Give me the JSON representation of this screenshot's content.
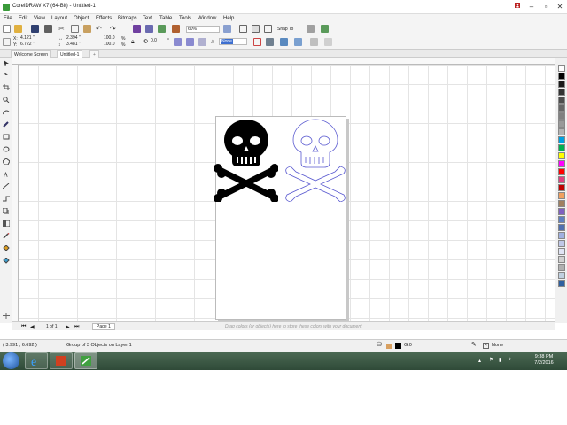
{
  "titlebar": {
    "title": "CorelDRAW X7 (64-Bit) - Untitled-1"
  },
  "menu": [
    {
      "label": "File"
    },
    {
      "label": "Edit"
    },
    {
      "label": "View"
    },
    {
      "label": "Layout"
    },
    {
      "label": "Object"
    },
    {
      "label": "Effects"
    },
    {
      "label": "Bitmaps"
    },
    {
      "label": "Text"
    },
    {
      "label": "Table"
    },
    {
      "label": "Tools"
    },
    {
      "label": "Window"
    },
    {
      "label": "Help"
    }
  ],
  "toolbar": {
    "zoom": "60%",
    "snap_to": "Snap To"
  },
  "propbar": {
    "x_label": "X:",
    "x": "4.121 \"",
    "y_label": "Y:",
    "y": "6.722 \"",
    "w": "2.394 \"",
    "h": "3.481 \"",
    "scale_w": "100.0",
    "scale_h": "100.0",
    "pct": "%",
    "angle": "0.0",
    "degree": "°",
    "outline": "None"
  },
  "tabs": {
    "welcome": "Welcome Screen",
    "doc": "Untitled-1",
    "add": "+"
  },
  "docnav": {
    "page_count": "1 of 1",
    "page_tab": "Page 1",
    "drag_hint": "Drag colors (or objects) here to store these colors with your document"
  },
  "status": {
    "coords": "( 3.991 , 6.692 )",
    "selection": "Group of 3 Objects on Layer 1",
    "fill": "G:0",
    "outline": "None"
  },
  "taskbar": {
    "time": "9:38 PM",
    "date": "7/2/2016"
  },
  "palette_colors": [
    "#ffffff",
    "#000000",
    "#1a1a1a",
    "#333333",
    "#4d4d4d",
    "#666666",
    "#808080",
    "#999999",
    "#b3b3b3",
    "#00a0e0",
    "#00b050",
    "#ffff00",
    "#ff00ff",
    "#ff0000",
    "#e04080",
    "#c00000",
    "#f0a060",
    "#a08060",
    "#8060c0",
    "#6080c0",
    "#5070b0",
    "#a0b0e0",
    "#c0c8e8",
    "#e0e4f4",
    "#d0d0d0",
    "#b0b0b0",
    "#c0d0e0",
    "#3060a0"
  ]
}
